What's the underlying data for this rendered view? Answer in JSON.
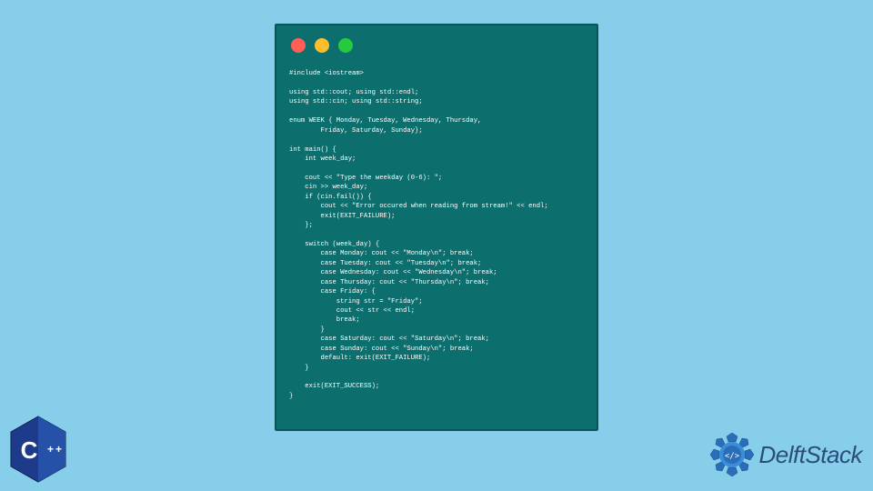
{
  "code_lines": "#include <iostream>\n\nusing std::cout; using std::endl;\nusing std::cin; using std::string;\n\nenum WEEK { Monday, Tuesday, Wednesday, Thursday,\n        Friday, Saturday, Sunday};\n\nint main() {\n    int week_day;\n\n    cout << \"Type the weekday (0-6): \";\n    cin >> week_day;\n    if (cin.fail()) {\n        cout << \"Error occured when reading from stream!\" << endl;\n        exit(EXIT_FAILURE);\n    };\n\n    switch (week_day) {\n        case Monday: cout << \"Monday\\n\"; break;\n        case Tuesday: cout << \"Tuesday\\n\"; break;\n        case Wednesday: cout << \"Wednesday\\n\"; break;\n        case Thursday: cout << \"Thursday\\n\"; break;\n        case Friday: {\n            string str = \"Friday\";\n            cout << str << endl;\n            break;\n        }\n        case Saturday: cout << \"Saturday\\n\"; break;\n        case Sunday: cout << \"Sunday\\n\"; break;\n        default: exit(EXIT_FAILURE);\n    }\n\n    exit(EXIT_SUCCESS);\n}",
  "logos": {
    "cpp_label": "C++",
    "delft_label": "DelftStack"
  },
  "colors": {
    "background": "#87ceeb",
    "window": "#0d6e6e",
    "red": "#ff5f56",
    "yellow": "#ffbd2e",
    "green": "#27c93f",
    "cpp_blue": "#1e3a8a",
    "delft_blue": "#2a4d7a"
  }
}
